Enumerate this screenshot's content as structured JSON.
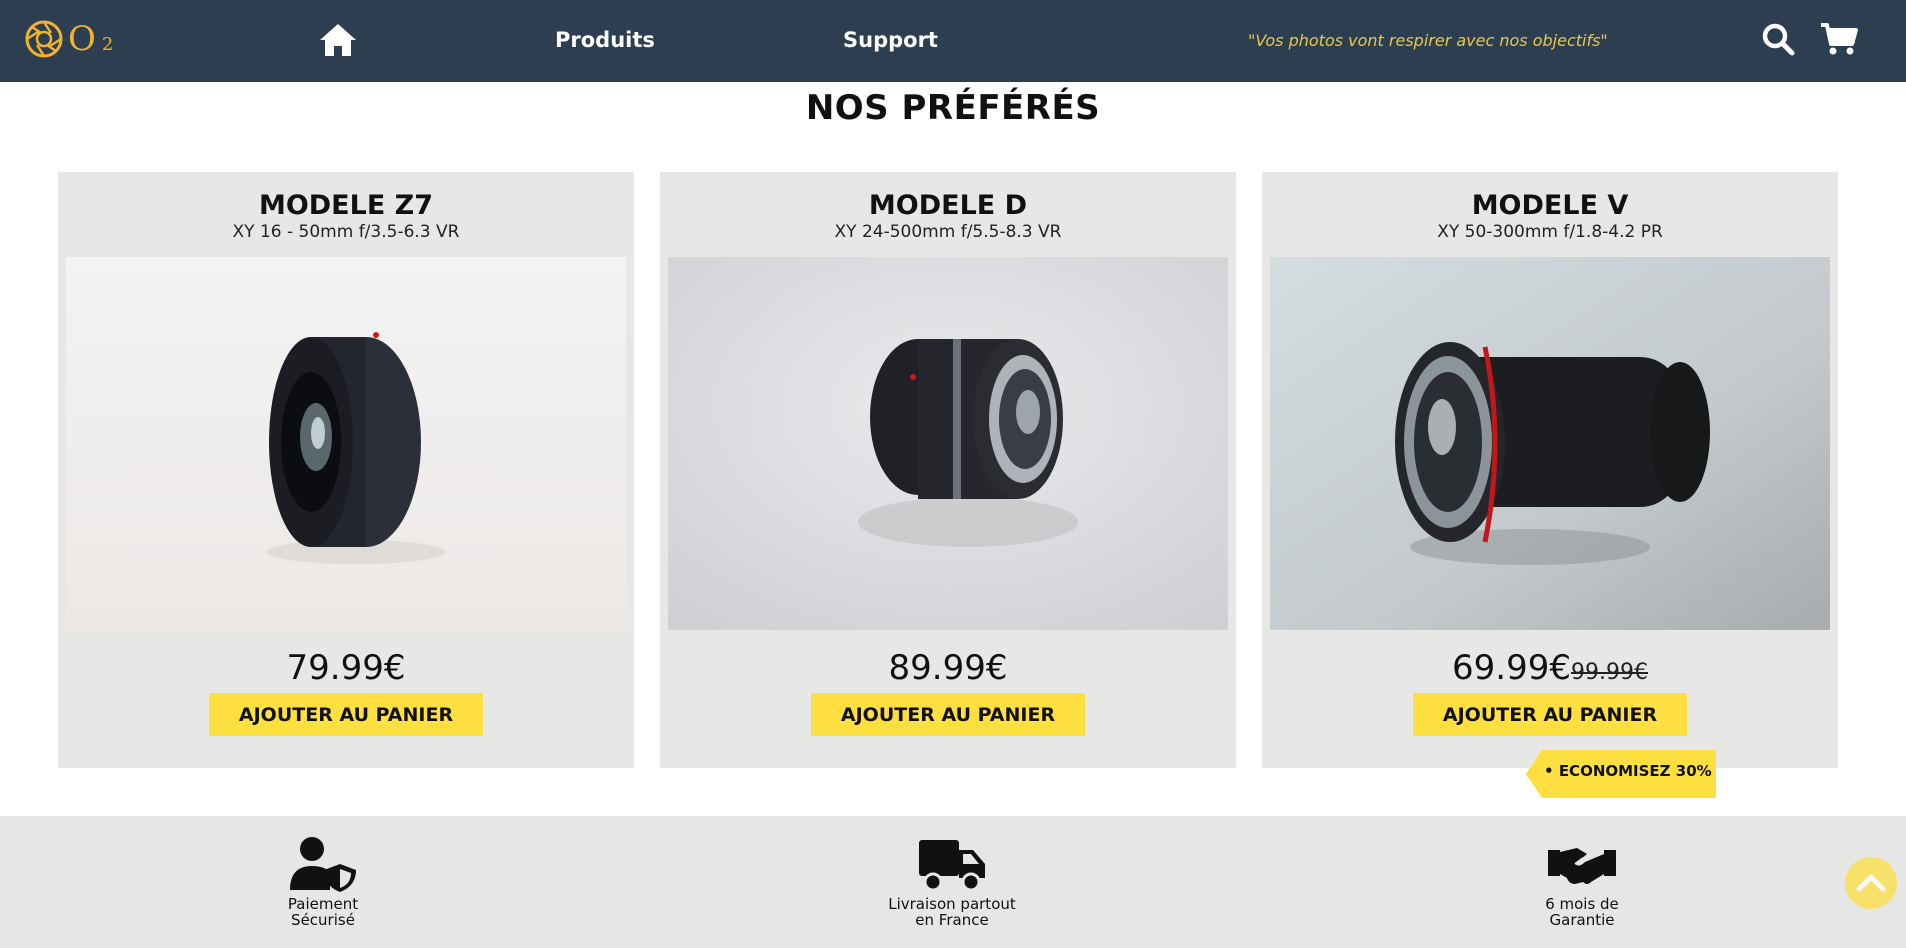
{
  "header": {
    "logo_text": "O",
    "logo_sub": "2",
    "nav": {
      "produits": "Produits",
      "support": "Support"
    },
    "slogan": "\"Vos photos vont respirer avec nos objectifs\""
  },
  "section_title": "NOS PRÉFÉRÉS",
  "products": [
    {
      "title": "MODELE Z7",
      "subtitle": "XY 16 - 50mm f/3.5-6.3 VR",
      "price": "79.99€",
      "button": "AJOUTER AU PANIER"
    },
    {
      "title": "MODELE D",
      "subtitle": "XY 24-500mm f/5.5-8.3 VR",
      "price": "89.99€",
      "button": "AJOUTER AU PANIER"
    },
    {
      "title": "MODELE V",
      "subtitle": "XY 50-300mm f/1.8-4.2 PR",
      "price": "69.99€",
      "old_price": "99.99€",
      "button": "AJOUTER AU PANIER",
      "badge": "ECONOMISEZ 30%"
    }
  ],
  "footer": {
    "features": [
      {
        "label": "Paiement\nSécurisé",
        "icon": "user-shield-icon"
      },
      {
        "label": "Livraison partout\nen France",
        "icon": "truck-icon"
      },
      {
        "label": "6 mois de\nGarantie",
        "icon": "handshake-icon"
      }
    ]
  },
  "colors": {
    "nav_bg": "#2d3e51",
    "accent": "#fde040",
    "card_bg": "#e7e8e6",
    "logo": "#f0b330",
    "slogan": "#e6c84a"
  }
}
